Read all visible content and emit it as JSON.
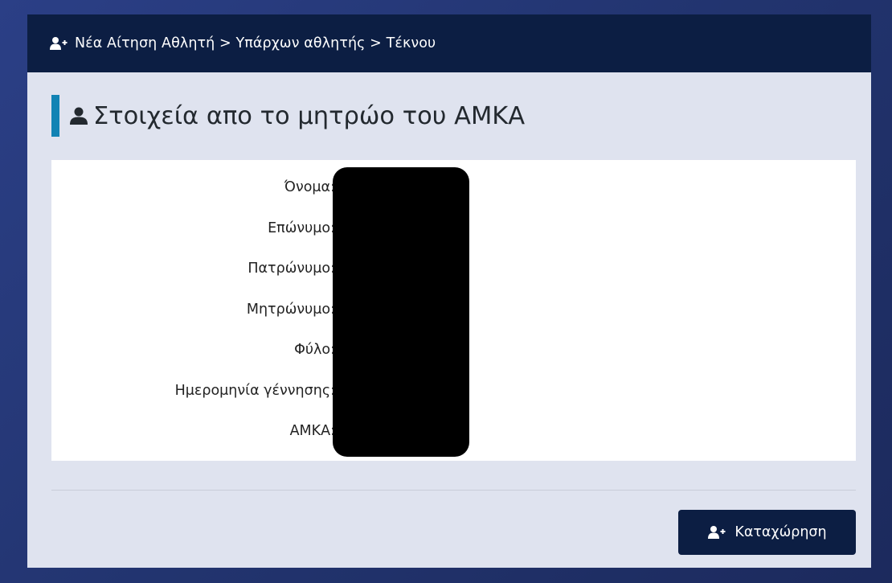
{
  "header": {
    "breadcrumb": "Νέα Αίτηση Αθλητή > Υπάρχων αθλητής > Τέκνου",
    "icon": "user-plus-icon"
  },
  "section": {
    "title": "Στοιχεία απο το μητρώο του ΑΜΚΑ",
    "icon": "user-icon"
  },
  "fields": [
    {
      "label": "Όνομα:"
    },
    {
      "label": "Επώνυμο:"
    },
    {
      "label": "Πατρώνυμο:"
    },
    {
      "label": "Μητρώνυμο:"
    },
    {
      "label": "Φύλο:"
    },
    {
      "label": "Ημερομηνία γέννησης:"
    },
    {
      "label": "ΑΜΚΑ:"
    }
  ],
  "actions": {
    "submit_label": "Καταχώρηση",
    "submit_icon": "user-plus-icon"
  },
  "colors": {
    "header_bg": "#0c1e43",
    "accent": "#1183b4",
    "card_bg": "#dfe3ef",
    "page_bg": "#22346f"
  }
}
